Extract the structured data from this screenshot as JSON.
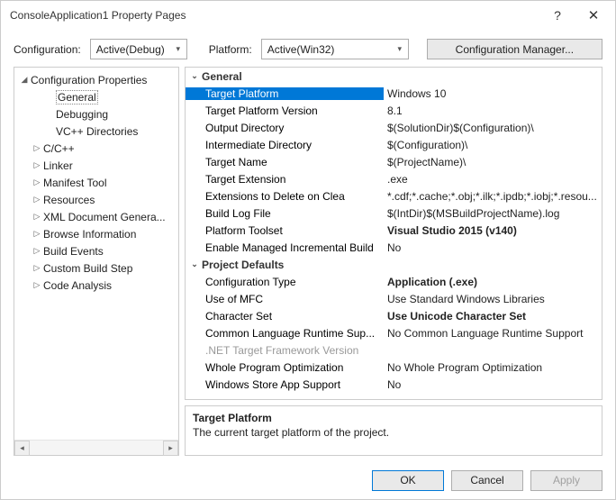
{
  "window": {
    "title": "ConsoleApplication1 Property Pages"
  },
  "top": {
    "config_label": "Configuration:",
    "config_value": "Active(Debug)",
    "platform_label": "Platform:",
    "platform_value": "Active(Win32)",
    "manager_btn": "Configuration Manager..."
  },
  "tree": {
    "root": "Configuration Properties",
    "items": [
      {
        "label": "General",
        "indent": 32,
        "arrow": "",
        "sel": true
      },
      {
        "label": "Debugging",
        "indent": 32,
        "arrow": ""
      },
      {
        "label": "VC++ Directories",
        "indent": 32,
        "arrow": ""
      },
      {
        "label": "C/C++",
        "indent": 18,
        "arrow": "▷"
      },
      {
        "label": "Linker",
        "indent": 18,
        "arrow": "▷"
      },
      {
        "label": "Manifest Tool",
        "indent": 18,
        "arrow": "▷"
      },
      {
        "label": "Resources",
        "indent": 18,
        "arrow": "▷"
      },
      {
        "label": "XML Document Genera...",
        "indent": 18,
        "arrow": "▷"
      },
      {
        "label": "Browse Information",
        "indent": 18,
        "arrow": "▷"
      },
      {
        "label": "Build Events",
        "indent": 18,
        "arrow": "▷"
      },
      {
        "label": "Custom Build Step",
        "indent": 18,
        "arrow": "▷"
      },
      {
        "label": "Code Analysis",
        "indent": 18,
        "arrow": "▷"
      }
    ]
  },
  "grid": {
    "group1": "General",
    "rows1": [
      {
        "name": "Target Platform",
        "value": "Windows 10",
        "sel": true
      },
      {
        "name": "Target Platform Version",
        "value": "8.1"
      },
      {
        "name": "Output Directory",
        "value": "$(SolutionDir)$(Configuration)\\"
      },
      {
        "name": "Intermediate Directory",
        "value": "$(Configuration)\\"
      },
      {
        "name": "Target Name",
        "value": "$(ProjectName)\\"
      },
      {
        "name": "Target Extension",
        "value": ".exe"
      },
      {
        "name": "Extensions to Delete on Clea",
        "value": "*.cdf;*.cache;*.obj;*.ilk;*.ipdb;*.iobj;*.resou..."
      },
      {
        "name": "Build Log File",
        "value": "$(IntDir)$(MSBuildProjectName).log"
      },
      {
        "name": "Platform Toolset",
        "value": "Visual Studio 2015 (v140)",
        "bold": true
      },
      {
        "name": "Enable Managed Incremental Build",
        "value": "No"
      }
    ],
    "group2": "Project Defaults",
    "rows2": [
      {
        "name": "Configuration Type",
        "value": "Application (.exe)",
        "bold": true
      },
      {
        "name": "Use of MFC",
        "value": "Use Standard Windows Libraries"
      },
      {
        "name": "Character Set",
        "value": "Use Unicode Character Set",
        "bold": true
      },
      {
        "name": "Common Language Runtime Sup...",
        "value": "No Common Language Runtime Support"
      },
      {
        "name": ".NET Target Framework Version",
        "value": "",
        "disabled": true
      },
      {
        "name": "Whole Program Optimization",
        "value": "No Whole Program Optimization"
      },
      {
        "name": "Windows Store App Support",
        "value": "No"
      }
    ]
  },
  "desc": {
    "title": "Target Platform",
    "text": "The current target platform of the project."
  },
  "footer": {
    "ok": "OK",
    "cancel": "Cancel",
    "apply": "Apply"
  }
}
